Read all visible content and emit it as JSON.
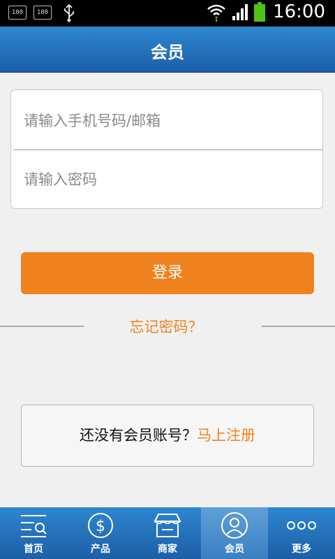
{
  "status_bar": {
    "badge1": "100",
    "badge2": "100",
    "time": "16:00"
  },
  "header": {
    "title": "会员"
  },
  "form": {
    "phone_placeholder": "请输入手机号码/邮箱",
    "password_placeholder": "请输入密码"
  },
  "login_label": "登录",
  "forgot_label": "忘记密码？",
  "register": {
    "prompt": "还没有会员账号？",
    "link": "马上注册"
  },
  "tabs": [
    {
      "label": "首页",
      "icon": "home-list-search-icon"
    },
    {
      "label": "产品",
      "icon": "dollar-circle-icon"
    },
    {
      "label": "商家",
      "icon": "store-icon"
    },
    {
      "label": "会员",
      "icon": "user-circle-icon"
    },
    {
      "label": "更多",
      "icon": "more-dots-icon"
    }
  ],
  "colors": {
    "accent": "#f0821e",
    "header_blue": "#2f86d0"
  }
}
